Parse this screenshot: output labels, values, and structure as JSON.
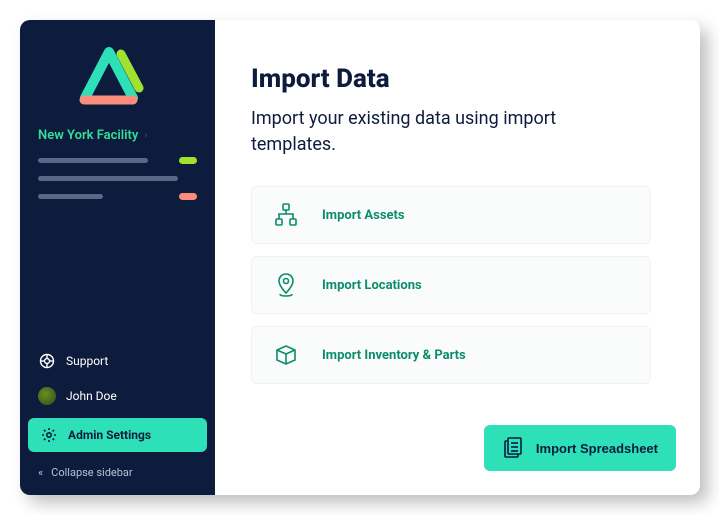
{
  "sidebar": {
    "facility_name": "New York Facility",
    "support_label": "Support",
    "user_name": "John Doe",
    "admin_label": "Admin Settings",
    "collapse_label": "Collapse sidebar"
  },
  "main": {
    "title": "Import Data",
    "subtitle": "Import your existing data using import templates.",
    "cards": [
      {
        "label": "Import Assets"
      },
      {
        "label": "Import Locations"
      },
      {
        "label": "Import Inventory & Parts"
      }
    ],
    "button_label": "Import Spreadsheet"
  },
  "colors": {
    "accent": "#2de0b8",
    "sidebar_bg": "#0d1b3d",
    "text_dark": "#0d1b3d",
    "link_green": "#0d8c6a"
  }
}
